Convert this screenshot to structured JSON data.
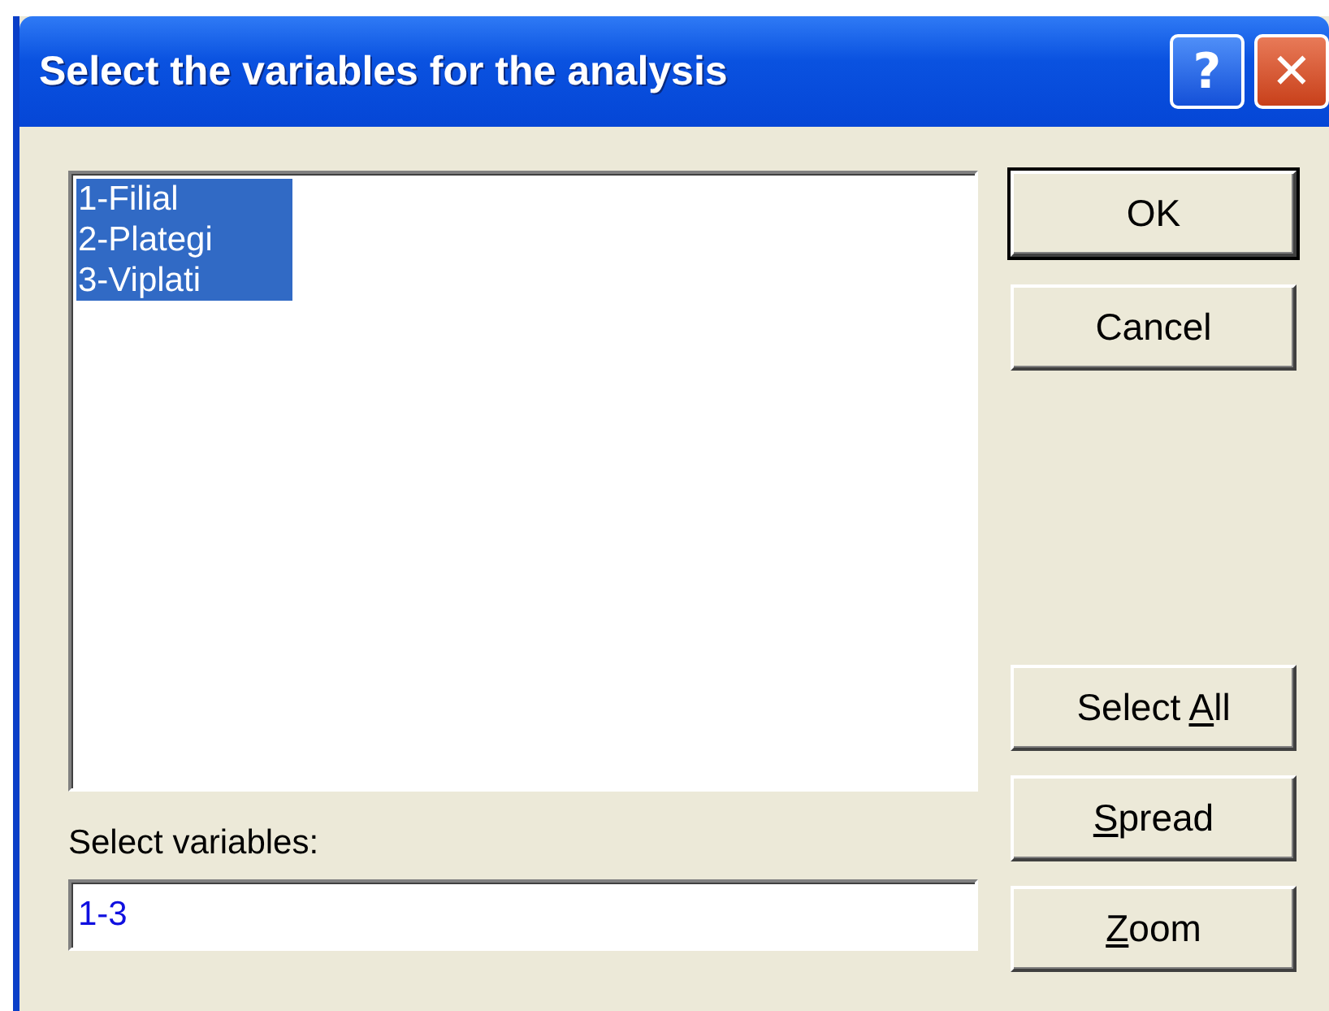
{
  "window": {
    "title": "Select the variables for the analysis",
    "help_button": "?",
    "close_button": "✕"
  },
  "variables": [
    {
      "label": "1-Filial",
      "selected": true
    },
    {
      "label": "2-Plategi",
      "selected": true
    },
    {
      "label": "3-Viplati",
      "selected": true
    }
  ],
  "select_field": {
    "label": "Select variables:",
    "value": "1-3"
  },
  "top_buttons": [
    {
      "label_start": "OK",
      "default": true
    },
    {
      "label_start": "Cancel",
      "default": false
    }
  ],
  "bottom_buttons": [
    {
      "label_start": "Select ",
      "access_key": "A",
      "label_end": "ll",
      "default": false
    },
    {
      "access_key": "S",
      "label_end": "pread",
      "default": false
    },
    {
      "access_key": "Z",
      "label_end": "oom",
      "default": false
    }
  ]
}
